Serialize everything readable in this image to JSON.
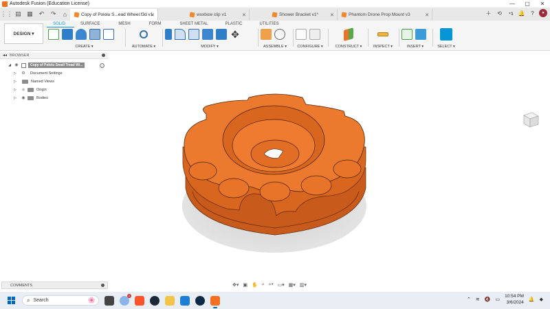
{
  "window": {
    "title": "Autodesk Fusion (Education License)",
    "minimize": "—",
    "maximize": "▢",
    "close": "✕"
  },
  "tabs": [
    {
      "label": "Copy of Pololu S...ead Wheel.f3d v1",
      "active": true
    },
    {
      "label": "wxxbow clip v1",
      "active": false
    },
    {
      "label": "Shower Bracket v1*",
      "active": false
    },
    {
      "label": "Phantom Drone Prop Mount v3",
      "active": false
    }
  ],
  "tab_close": "✕",
  "account": {
    "job_count": "1"
  },
  "ribbon": {
    "design_label": "DESIGN ▾",
    "workspace_tabs": [
      "SOLID",
      "SURFACE",
      "MESH",
      "FORM",
      "SHEET METAL",
      "PLASTIC",
      "UTILITIES"
    ],
    "groups": {
      "create": "CREATE ▾",
      "automate": "AUTOMATE ▾",
      "modify": "MODIFY ▾",
      "assemble": "ASSEMBLE ▾",
      "configure": "CONFIGURE ▾",
      "construct": "CONSTRUCT ▾",
      "inspect": "INSPECT ▾",
      "insert": "INSERT ▾",
      "select": "SELECT ▾"
    }
  },
  "browser": {
    "title": "BROWSER",
    "root": "Copy of Pololu Small Tread Wi...",
    "items": [
      "Document Settings",
      "Named Views",
      "Origin",
      "Bodies"
    ]
  },
  "comments": {
    "title": "COMMENTS"
  },
  "taskbar": {
    "search_placeholder": "Search",
    "notification_count": "1",
    "time": "10:54 PM",
    "date": "3/6/2024"
  },
  "colors": {
    "accent": "#0696d7",
    "part_orange": "#e8742a",
    "fusion_brand": "#f37021"
  }
}
